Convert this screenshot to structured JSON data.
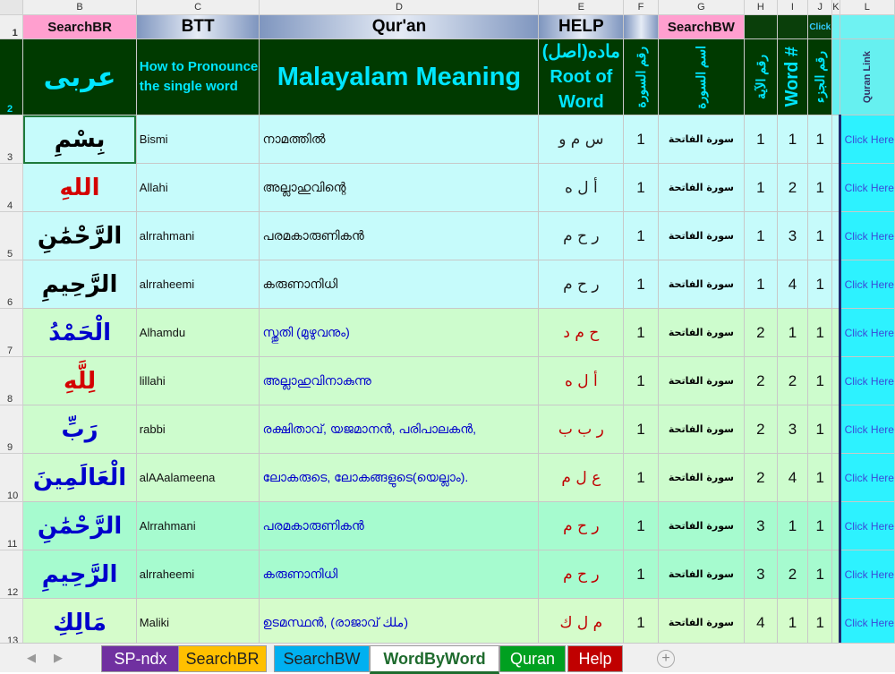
{
  "columns": [
    "",
    "B",
    "C",
    "D",
    "E",
    "F",
    "G",
    "H",
    "I",
    "J",
    "K",
    "L"
  ],
  "row1": {
    "num": "1",
    "searchbr": "SearchBR",
    "btt": "BTT",
    "quran": "Qur'an",
    "help": "HELP",
    "searchbw": "SearchBW",
    "click": "Click"
  },
  "row2": {
    "num": "2",
    "arabic": "عربى",
    "howto": "How to Pronounce the single word",
    "meaning": "Malayalam Meaning",
    "root_ar": "ماده(اصل)",
    "root_en": "Root of Word",
    "surah_no": "رقم السورة",
    "surah_name": "اسم السورة",
    "ayah_no": "رقم الآية",
    "word_no": "Word #",
    "juz_no": "رقم الجزء",
    "quran_link": "Quran Link"
  },
  "rows": [
    {
      "num": "3",
      "word": "بِسْمِ",
      "pron": "Bismi",
      "meaning": "നാമത്തിൽ",
      "root": "س م و",
      "surah": "1",
      "surah_name": "سورة الفاتحة",
      "ayah": "1",
      "wordno": "1",
      "juz": "1",
      "link": "Click Here"
    },
    {
      "num": "4",
      "word": "اللهِ",
      "pron": "Allahi",
      "meaning": "അല്ലാഹുവിന്റെ",
      "root": "أ ل ه",
      "surah": "1",
      "surah_name": "سورة الفاتحة",
      "ayah": "1",
      "wordno": "2",
      "juz": "1",
      "link": "Click Here"
    },
    {
      "num": "5",
      "word": "الرَّحْمَٰنِ",
      "pron": "alrrahmani",
      "meaning": "പരമകാരുണികൻ",
      "root": "ر ح م",
      "surah": "1",
      "surah_name": "سورة الفاتحة",
      "ayah": "1",
      "wordno": "3",
      "juz": "1",
      "link": "Click Here"
    },
    {
      "num": "6",
      "word": "الرَّحِيمِ",
      "pron": "alrraheemi",
      "meaning": "കരുണാനിധി",
      "root": "ر ح م",
      "surah": "1",
      "surah_name": "سورة الفاتحة",
      "ayah": "1",
      "wordno": "4",
      "juz": "1",
      "link": "Click Here"
    },
    {
      "num": "7",
      "word": "الْحَمْدُ",
      "pron": "Alhamdu",
      "meaning": "സ്തുതി (മുഴുവനും)",
      "root": "ح م د",
      "surah": "1",
      "surah_name": "سورة الفاتحة",
      "ayah": "2",
      "wordno": "1",
      "juz": "1",
      "link": "Click Here"
    },
    {
      "num": "8",
      "word": "لِلَّهِ",
      "pron": "lillahi",
      "meaning": "അല്ലാഹുവിനാകുന്നു",
      "root": "أ ل ه",
      "surah": "1",
      "surah_name": "سورة الفاتحة",
      "ayah": "2",
      "wordno": "2",
      "juz": "1",
      "link": "Click Here"
    },
    {
      "num": "9",
      "word": "رَبِّ",
      "pron": "rabbi",
      "meaning": "രക്ഷിതാവ്, യജമാനൻ, പരിപാലകൻ,",
      "root": "ر ب ب",
      "surah": "1",
      "surah_name": "سورة الفاتحة",
      "ayah": "2",
      "wordno": "3",
      "juz": "1",
      "link": "Click Here"
    },
    {
      "num": "10",
      "word": "الْعَالَمِينَ",
      "pron": "alAAalameena",
      "meaning": "ലോകരുടെ, ലോകങ്ങളുടെ(യെല്ലാം).",
      "root": "ع ل م",
      "surah": "1",
      "surah_name": "سورة الفاتحة",
      "ayah": "2",
      "wordno": "4",
      "juz": "1",
      "link": "Click Here"
    },
    {
      "num": "11",
      "word": "الرَّحْمَٰنِ",
      "pron": "Alrrahmani",
      "meaning": "പരമകാരുണികൻ",
      "root": "ر ح م",
      "surah": "1",
      "surah_name": "سورة الفاتحة",
      "ayah": "3",
      "wordno": "1",
      "juz": "1",
      "link": "Click Here"
    },
    {
      "num": "12",
      "word": "الرَّحِيمِ",
      "pron": "alrraheemi",
      "meaning": "കരുണാനിധി",
      "root": "ر ح م",
      "surah": "1",
      "surah_name": "سورة الفاتحة",
      "ayah": "3",
      "wordno": "2",
      "juz": "1",
      "link": "Click Here"
    },
    {
      "num": "13",
      "word": "مَالِكِ",
      "pron": "Maliki",
      "meaning": "ഉടമസ്ഥൻ, (രാജാവ് ملك)",
      "root": "م ل ك",
      "surah": "1",
      "surah_name": "سورة الفاتحة",
      "ayah": "4",
      "wordno": "1",
      "juz": "1",
      "link": "Click Here"
    }
  ],
  "tabs": [
    "SP-ndx",
    "SearchBR",
    "SearchBW",
    "WordByWord",
    "Quran",
    "Help"
  ],
  "active_tab": "WordByWord",
  "nav": {
    "prev": "◀",
    "next": "▶",
    "add": "+"
  },
  "colors": {
    "header_dark": "#003a00",
    "header_text": "#00e6ff",
    "pink": "#ff9fcf",
    "link_cyan": "#2df2ff"
  }
}
